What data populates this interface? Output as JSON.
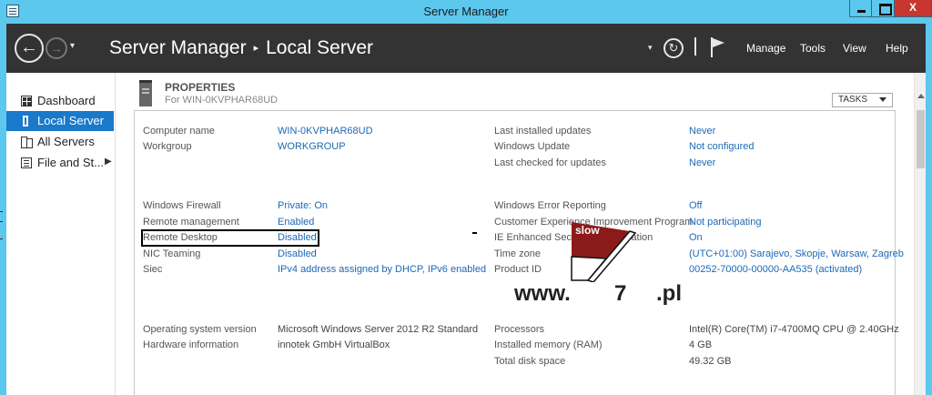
{
  "window": {
    "title": "Server Manager",
    "app_icon": "server-manager-icon",
    "controls": {
      "minimize": "",
      "maximize": "",
      "close": "X"
    }
  },
  "header": {
    "breadcrumb_root": "Server Manager",
    "breadcrumb_sep": "▸",
    "breadcrumb_current": "Local Server",
    "back_icon": "←",
    "forward_icon": "→",
    "dropdown_icon": "▾",
    "refresh_icon": "↻",
    "menu": {
      "manage": "Manage",
      "tools": "Tools",
      "view": "View",
      "help": "Help"
    }
  },
  "sidebar": {
    "items": [
      {
        "label": "Dashboard",
        "icon": "dashboard-icon"
      },
      {
        "label": "Local Server",
        "icon": "local-server-icon",
        "active": true
      },
      {
        "label": "All Servers",
        "icon": "all-servers-icon"
      },
      {
        "label": "File and St...",
        "icon": "file-storage-icon",
        "arrow": "▶"
      }
    ]
  },
  "properties": {
    "title": "PROPERTIES",
    "subtitle": "For WIN-0KVPHAR68UD",
    "tasks_label": "TASKS",
    "left": [
      {
        "label": "Computer name",
        "value": "WIN-0KVPHAR68UD"
      },
      {
        "label": "Workgroup",
        "value": "WORKGROUP"
      },
      {
        "label": "Windows Firewall",
        "value": "Private: On"
      },
      {
        "label": "Remote management",
        "value": "Enabled"
      },
      {
        "label": "Remote Desktop",
        "value": "Disabled"
      },
      {
        "label": "NIC Teaming",
        "value": "Disabled"
      },
      {
        "label": "Siec",
        "value": "IPv4 address assigned by DHCP, IPv6 enabled"
      },
      {
        "label": "Operating system version",
        "value": "Microsoft Windows Server 2012 R2 Standard"
      },
      {
        "label": "Hardware information",
        "value": "innotek GmbH VirtualBox"
      }
    ],
    "right": [
      {
        "label": "Last installed updates",
        "value": "Never"
      },
      {
        "label": "Windows Update",
        "value": "Not configured"
      },
      {
        "label": "Last checked for updates",
        "value": "Never"
      },
      {
        "label": "Windows Error Reporting",
        "value": "Off"
      },
      {
        "label": "Customer Experience Improvement Program",
        "value": "Not participating"
      },
      {
        "label": "IE Enhanced Security Configuration",
        "value": "On"
      },
      {
        "label": "Time zone",
        "value": "(UTC+01:00) Sarajevo, Skopje, Warsaw, Zagreb"
      },
      {
        "label": "Product ID",
        "value": "00252-70000-00000-AA535 (activated)"
      },
      {
        "label": "Processors",
        "value": "Intel(R) Core(TM) i7-4700MQ CPU @ 2.40GHz"
      },
      {
        "label": "Installed memory (RAM)",
        "value": "4 GB"
      },
      {
        "label": "Total disk space",
        "value": "49.32 GB"
      }
    ]
  },
  "watermark": {
    "prefix": "www.",
    "slow": "slow",
    "seven": "7",
    "suffix": ".pl"
  }
}
